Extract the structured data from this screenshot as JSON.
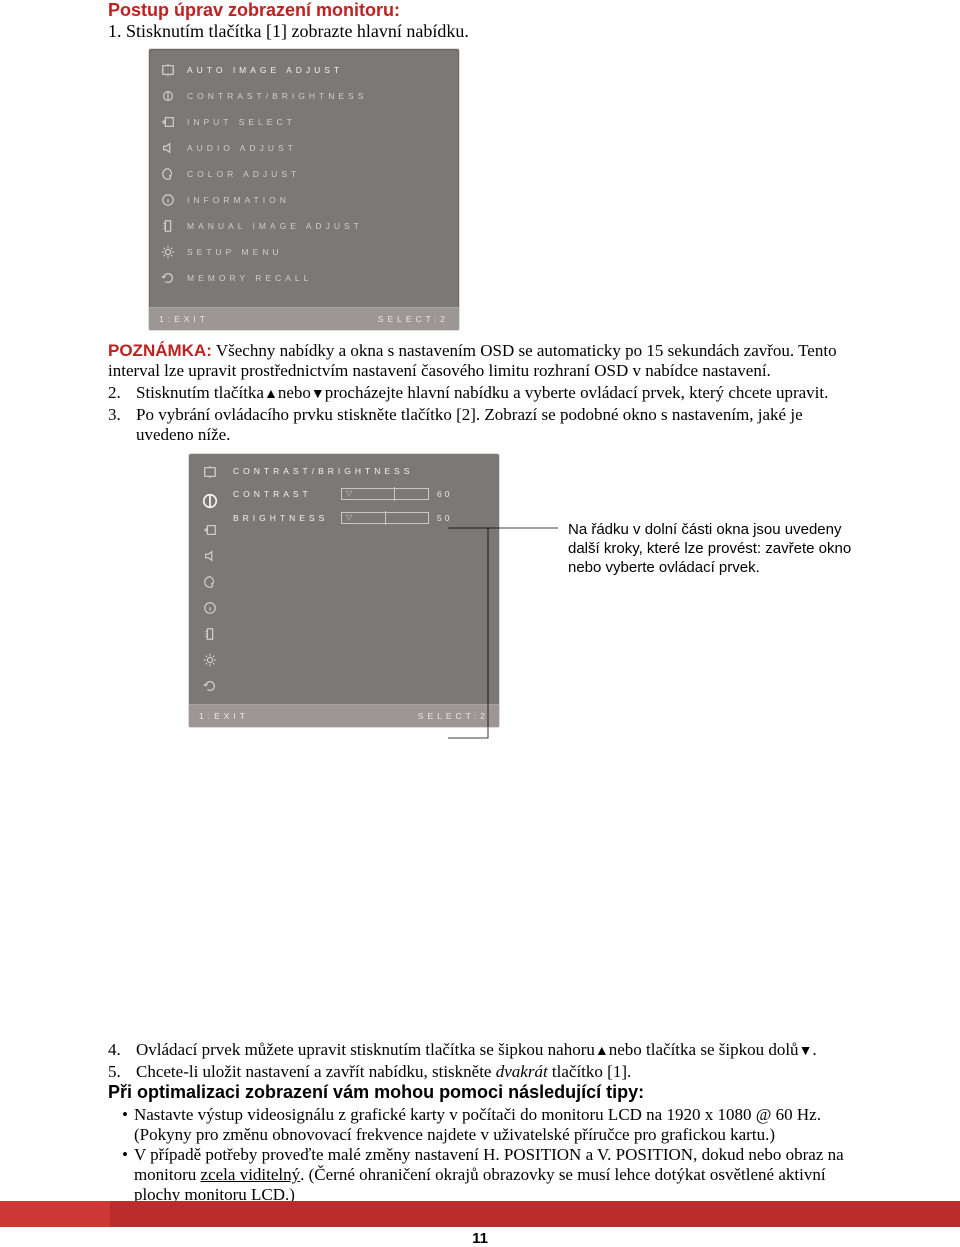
{
  "title": "Postup úprav zobrazení monitoru:",
  "step1": "1.  Stisknutím tlačítka [1] zobrazte hlavní nabídku.",
  "osd1": {
    "items": [
      "AUTO IMAGE ADJUST",
      "CONTRAST/BRIGHTNESS",
      "INPUT SELECT",
      "AUDIO ADJUST",
      "COLOR ADJUST",
      "INFORMATION",
      "MANUAL IMAGE ADJUST",
      "SETUP MENU",
      "MEMORY RECALL"
    ],
    "footer_left": "1:EXIT",
    "footer_right": "SELECT:2"
  },
  "note_label": "POZNÁMKA:",
  "note_body": " Všechny nabídky a okna s nastavením OSD se automaticky po 15 sekundách zavřou. Tento interval lze upravit prostřednictvím nastavení časového limitu rozhraní OSD v nabídce nastavení.",
  "step2_num": "2.",
  "step2_a": "Stisknutím tlačítka",
  "step2_b": "nebo",
  "step2_c": "procházejte hlavní nabídku a vyberte ovládací prvek, který chcete upravit.",
  "step3_num": "3.",
  "step3": "Po vybrání ovládacího prvku stiskněte tlačítko [2]. Zobrazí se podobné okno s nastavením, jaké je uvedeno níže.",
  "osd2": {
    "heading": "CONTRAST/BRIGHTNESS",
    "rows": [
      {
        "label": "CONTRAST",
        "value": "60",
        "fill": 60
      },
      {
        "label": "BRIGHTNESS",
        "value": "50",
        "fill": 50
      }
    ],
    "footer_left": "1:EXIT",
    "footer_right": "SELECT:2"
  },
  "callout": "Na řádku v dolní části okna jsou uvedeny další kroky, které lze provést: zavřete okno nebo vyberte ovládací prvek.",
  "step4_num": "4.",
  "step4_a": "Ovládací prvek můžete upravit stisknutím tlačítka se šipkou nahoru",
  "step4_b": "nebo tlačítka se šipkou dolů",
  "step4_c": ".",
  "step5_num": "5.",
  "step5_a": "Chcete-li uložit nastavení a zavřít nabídku, stiskněte ",
  "step5_em": "dvakrát",
  "step5_b": " tlačítko [1].",
  "tips_title": "Při optimalizaci zobrazení vám mohou pomoci následující tipy:",
  "tips": [
    "Nastavte výstup videosignálu z grafické karty v počítači do monitoru LCD na 1920 x 1080 @ 60 Hz. (Pokyny pro změnu obnovovací frekvence najdete v uživatelské příručce pro grafickou kartu.)",
    {
      "a": "V případě potřeby proveďte malé změny nastavení H. POSITION a V. POSITION, dokud nebo obraz na monitoru ",
      "u": "zcela viditelný",
      "b": ". (Černé ohraničení okrajů obrazovky se musí lehce dotýkat osvětlené aktivní plochy monitoru LCD.)"
    }
  ],
  "page_num": "11"
}
